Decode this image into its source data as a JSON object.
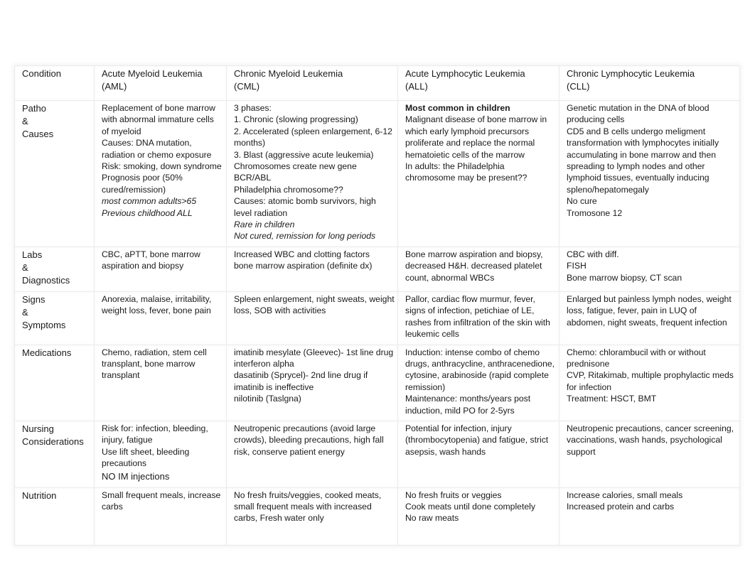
{
  "table": {
    "header": {
      "condition_label": "Condition",
      "columns": [
        {
          "name": "Acute Myeloid Leukemia",
          "abbr": "(AML)"
        },
        {
          "name": "Chronic Myeloid Leukemia",
          "abbr": "(CML)"
        },
        {
          "name": "Acute Lymphocytic Leukemia",
          "abbr": "(ALL)"
        },
        {
          "name": "Chronic Lymphocytic Leukemia",
          "abbr": "(CLL)"
        }
      ]
    },
    "rows": [
      {
        "label_lines": [
          "Patho",
          "&",
          "Causes"
        ],
        "cells": [
          [
            {
              "text": "Replacement of bone marrow with abnormal immature cells of myeloid"
            },
            {
              "text": "Causes: DNA mutation, radiation or chemo exposure"
            },
            {
              "text": "Risk: smoking, down syndrome"
            },
            {
              "text": "Prognosis poor (50% cured/remission)"
            },
            {
              "text": "most common adults>65",
              "style": "italic"
            },
            {
              "text": "Previous childhood ALL",
              "style": "italic"
            }
          ],
          [
            {
              "text": "3 phases:"
            },
            {
              "text": "1. Chronic (slowing progressing)"
            },
            {
              "text": "2. Accelerated (spleen enlargement, 6-12 months)"
            },
            {
              "text": "3. Blast (aggressive acute leukemia)"
            },
            {
              "text": "Chromosomes create new gene BCR/ABL"
            },
            {
              "text": "Philadelphia chromosome??"
            },
            {
              "text": "Causes: atomic bomb survivors, high level radiation"
            },
            {
              "text": "Rare in children",
              "style": "italic"
            },
            {
              "text": "Not cured, remission for long periods",
              "style": "italic"
            }
          ],
          [
            {
              "text": "Most common in children",
              "style": "bold"
            },
            {
              "text": "Malignant disease of bone marrow in which early lymphoid precursors proliferate and replace the normal hematoietic cells of the marrow"
            },
            {
              "text": "In adults: the Philadelphia chromosome may be present??"
            }
          ],
          [
            {
              "text": "Genetic mutation in the DNA of blood producing cells"
            },
            {
              "text": "CD5 and B cells undergo meligment transformation with lymphocytes initially accumulating in bone marrow and then spreading to lymph nodes and other lymphoid tissues, eventually inducing spleno/hepatomegaly"
            },
            {
              "text": "No cure"
            },
            {
              "text": "Tromosone 12"
            }
          ]
        ]
      },
      {
        "label_lines": [
          "Labs",
          "&",
          "Diagnostics"
        ],
        "cells": [
          [
            {
              "text": "CBC, aPTT, bone marrow aspiration and biopsy"
            }
          ],
          [
            {
              "text": "Increased WBC and clotting factors"
            },
            {
              "text": "bone marrow aspiration (definite dx)"
            }
          ],
          [
            {
              "text": "Bone marrow aspiration and biopsy, decreased H&H. decreased platelet count, abnormal WBCs"
            }
          ],
          [
            {
              "text": "CBC with diff."
            },
            {
              "text": "FISH"
            },
            {
              "text": "Bone marrow biopsy, CT scan"
            }
          ]
        ]
      },
      {
        "label_lines": [
          "Signs",
          "&",
          "Symptoms"
        ],
        "cells": [
          [
            {
              "text": "Anorexia, malaise, irritability, weight loss, fever, bone pain"
            }
          ],
          [
            {
              "text": "Spleen enlargement, night sweats, weight loss, SOB with activities"
            }
          ],
          [
            {
              "text": "Pallor, cardiac flow murmur, fever, signs of infection, petichiae of LE, rashes from infiltration of the skin with leukemic cells"
            }
          ],
          [
            {
              "text": "Enlarged but painless lymph nodes, weight loss, fatigue, fever, pain in LUQ of abdomen, night sweats, frequent infection"
            }
          ]
        ]
      },
      {
        "label_lines": [
          "Medications"
        ],
        "cells": [
          [
            {
              "text": "Chemo, radiation, stem cell transplant, bone marrow transplant"
            }
          ],
          [
            {
              "text": "imatinib mesylate (Gleevec)- 1st line drug"
            },
            {
              "text": "interferon alpha"
            },
            {
              "text": "dasatinib (Sprycel)- 2nd line drug if imatinib is ineffective"
            },
            {
              "text": "nilotinib (Taslgna)"
            }
          ],
          [
            {
              "text": "Induction: intense combo of chemo drugs, anthracycline, anthracenedione, cytosine, arabinoside (rapid complete remission)"
            },
            {
              "text": "Maintenance: months/years post induction, mild PO for 2-5yrs"
            }
          ],
          [
            {
              "text": "Chemo: chlorambucil with or without prednisone"
            },
            {
              "text": "CVP, Ritakimab, multiple prophylactic meds for infection"
            },
            {
              "text": "Treatment: HSCT, BMT"
            }
          ]
        ]
      },
      {
        "label_lines": [
          "Nursing",
          "Considerations"
        ],
        "cells": [
          [
            {
              "text": "Risk for: infection, bleeding, injury, fatigue"
            },
            {
              "text": "Use lift sheet, bleeding precautions"
            },
            {
              "text": "NO IM injections",
              "style": "big"
            }
          ],
          [
            {
              "text": "Neutropenic precautions (avoid large crowds), bleeding precautions, high fall risk, conserve patient energy"
            }
          ],
          [
            {
              "text": "Potential for infection, injury (thrombocytopenia) and fatigue, strict asepsis, wash hands"
            }
          ],
          [
            {
              "text": "Neutropenic precautions, cancer screening, vaccinations, wash hands, psychological support"
            }
          ]
        ]
      },
      {
        "label_lines": [
          "Nutrition"
        ],
        "cells": [
          [
            {
              "text": "Small frequent meals, increase carbs"
            }
          ],
          [
            {
              "text": "No fresh fruits/veggies, cooked meats, small frequent meals with increased carbs, Fresh water only"
            }
          ],
          [
            {
              "text": "No fresh fruits or veggies"
            },
            {
              "text": "Cook meats until done completely"
            },
            {
              "text": "No raw meats"
            }
          ],
          [
            {
              "text": "Increase calories, small meals"
            },
            {
              "text": "Increased protein and carbs"
            }
          ]
        ]
      }
    ]
  }
}
